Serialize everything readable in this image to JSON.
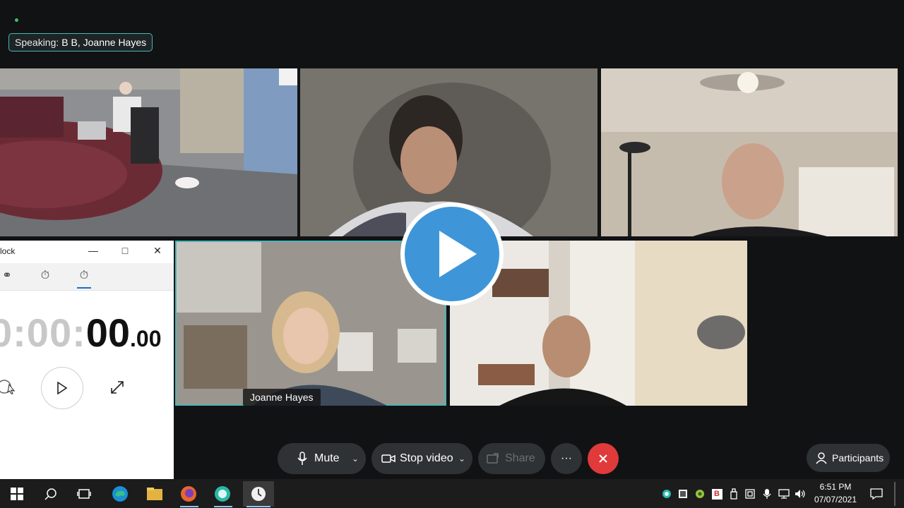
{
  "speaking": {
    "prefix": "Speaking:",
    "names": "B B, Joanne Hayes"
  },
  "participants": [
    {
      "name": "Joanne Hayes"
    }
  ],
  "clock_app": {
    "title": "lock",
    "faded_time": "0:00:",
    "seconds": "00",
    "fraction": ".00",
    "tabs": [
      "world-clock-tab",
      "timer-tab",
      "stopwatch-tab"
    ]
  },
  "toolbar": {
    "mute_label": "Mute",
    "stop_video_label": "Stop video",
    "share_label": "Share",
    "more_label": "···",
    "participants_label": "Participants"
  },
  "taskbar": {
    "time": "6:51 PM",
    "date": "07/07/2021",
    "tray_letter": "B"
  },
  "colors": {
    "speaker_outline": "#49b6b6",
    "end_call": "#e03a3a",
    "play_overlay": "#3e96d8"
  }
}
